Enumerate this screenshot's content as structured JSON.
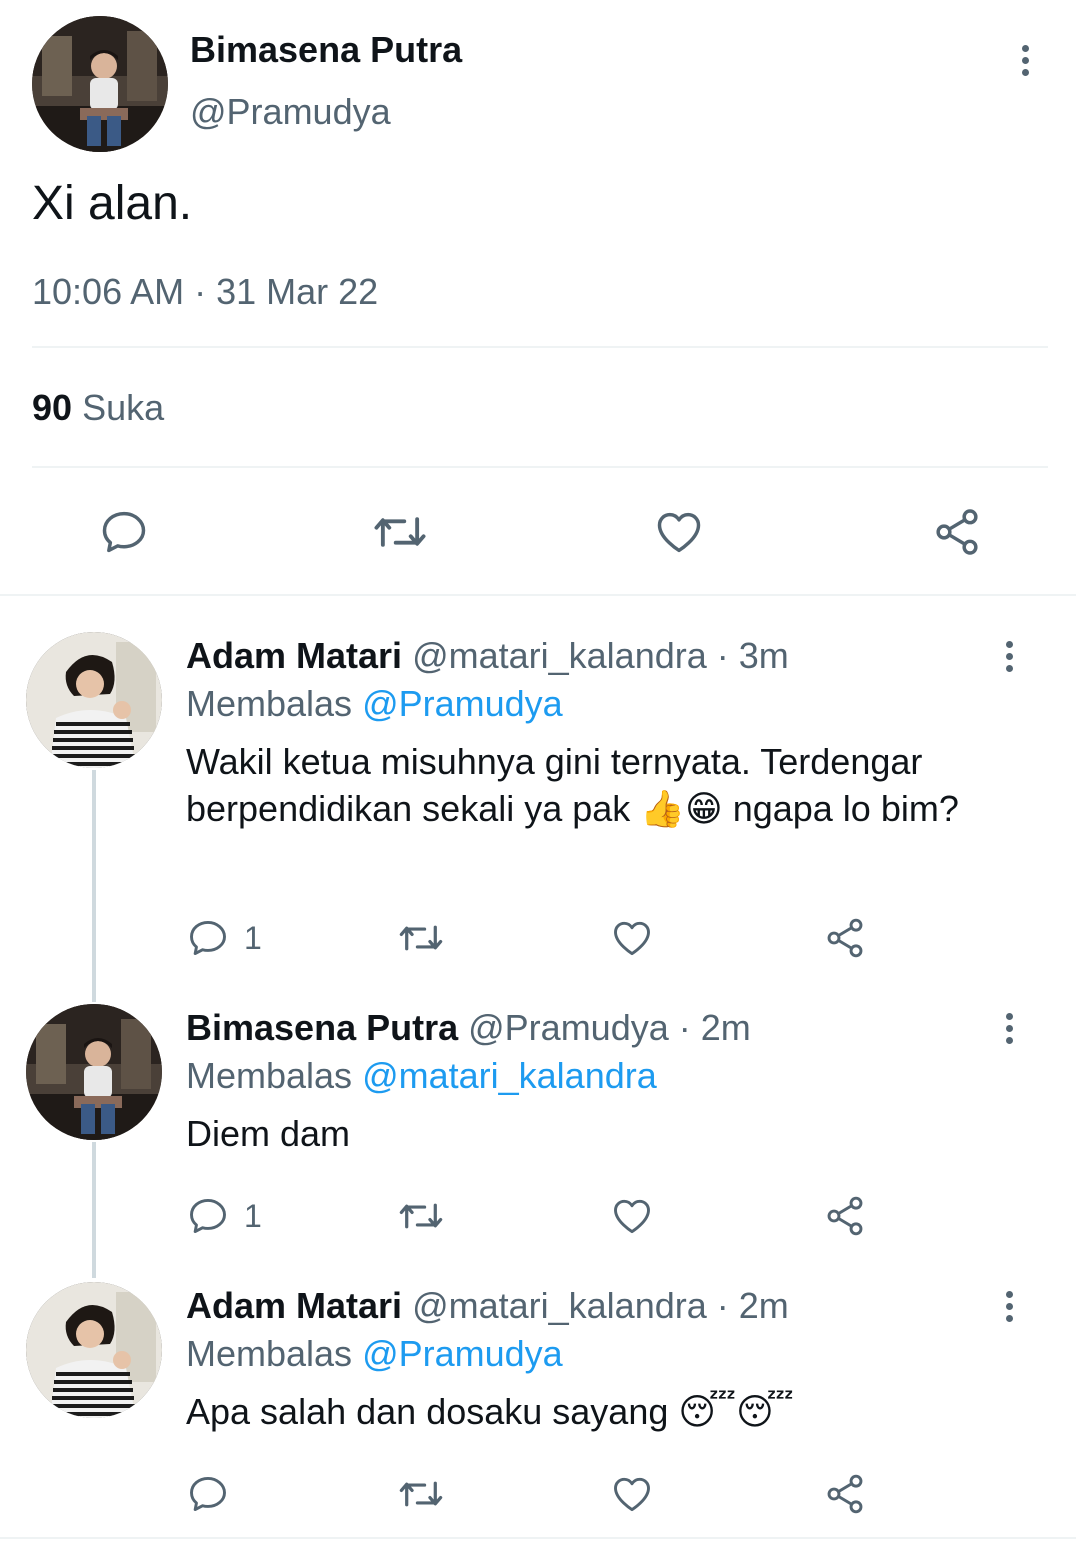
{
  "main_tweet": {
    "author_name": "Bimasena Putra",
    "author_handle": "@Pramudya",
    "text": "Xi alan.",
    "timestamp": "10:06 AM · 31 Mar 22",
    "likes_count": "90",
    "likes_label": "Suka"
  },
  "replies": [
    {
      "author_name": "Adam Matari",
      "author_handle": "@matari_kalandra",
      "time": "· 3m",
      "replying_label": "Membalas",
      "replying_to": "@Pramudya",
      "text_part1": "Wakil ketua misuhnya gini ternyata. Terdengar berpendidikan sekali ya pak",
      "emojis_part1": "👍😁",
      "text_part2": "ngapa lo bim?",
      "reply_count": "1"
    },
    {
      "author_name": "Bimasena Putra",
      "author_handle": "@Pramudya",
      "time": "· 2m",
      "replying_label": "Membalas",
      "replying_to": "@matari_kalandra",
      "text": "Diem dam",
      "reply_count": "1"
    },
    {
      "author_name": "Adam Matari",
      "author_handle": "@matari_kalandra",
      "time": "· 2m",
      "replying_label": "Membalas",
      "replying_to": "@Pramudya",
      "text": "Apa salah dan dosaku sayang",
      "emojis": "😴😴"
    }
  ],
  "colors": {
    "accent": "#1d9bf0",
    "secondary_text": "#536471",
    "primary_text": "#0f1419",
    "divider": "#eff3f4"
  }
}
